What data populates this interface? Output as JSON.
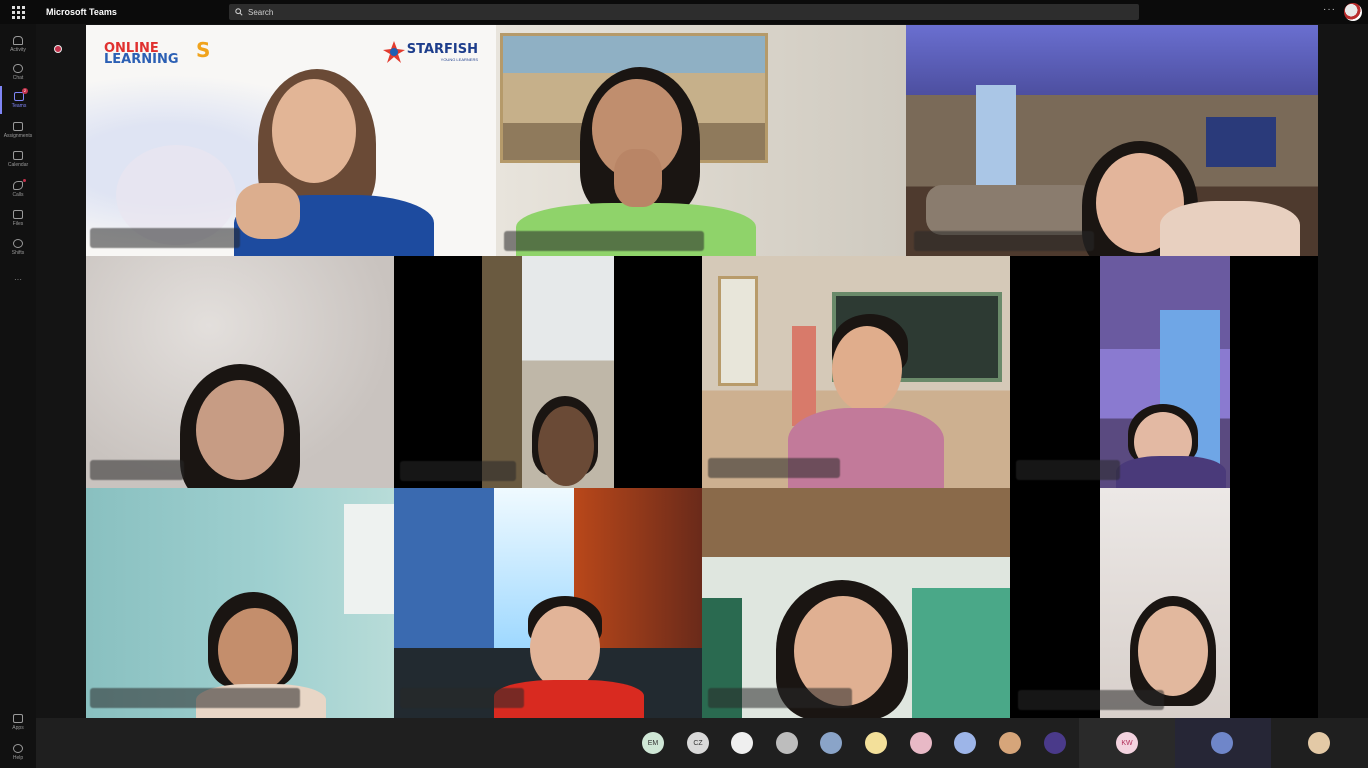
{
  "app": {
    "title": "Microsoft Teams"
  },
  "search": {
    "placeholder": "Search"
  },
  "topbar": {
    "more_label": "···"
  },
  "rail": [
    {
      "name": "activity",
      "label": "Activity"
    },
    {
      "name": "chat",
      "label": "Chat"
    },
    {
      "name": "teams",
      "label": "Teams",
      "badge": "2",
      "active": true
    },
    {
      "name": "assignments",
      "label": "Assignments"
    },
    {
      "name": "calendar",
      "label": "Calendar"
    },
    {
      "name": "calls",
      "label": "Calls",
      "dot": true
    },
    {
      "name": "files",
      "label": "Files"
    },
    {
      "name": "shifts",
      "label": "Shifts"
    }
  ],
  "rail_more": "···",
  "rail_bottom": [
    {
      "name": "apps",
      "label": "Apps"
    },
    {
      "name": "help",
      "label": "Help"
    }
  ],
  "presenter_tile": {
    "logo_left_line1": "ONLINE",
    "logo_left_line2": "LEARNING",
    "logo_left_mark": "S",
    "logo_right": "STARFISH",
    "logo_right_sub": "YOUNG LEARNERS"
  },
  "participants_dock": [
    {
      "initials": "EM",
      "color": "#cfe7d6"
    },
    {
      "initials": "CZ",
      "color": "#d9d9d9"
    },
    {
      "initials": "",
      "color": "#efefef"
    },
    {
      "initials": "",
      "color": "#bdbdbd"
    },
    {
      "initials": "",
      "color": "#8aa4c8"
    },
    {
      "initials": "",
      "color": "#f3e09a"
    },
    {
      "initials": "",
      "color": "#e8b9c6"
    },
    {
      "initials": "",
      "color": "#9db5e8"
    },
    {
      "initials": "",
      "color": "#d6a57a"
    },
    {
      "initials": "",
      "color": "#4a3a8a"
    },
    {
      "initials": "KW",
      "color": "#f3d3df"
    },
    {
      "initials": "",
      "color": "#6f86c9"
    },
    {
      "initials": "",
      "color": "#e3c9a6"
    }
  ]
}
